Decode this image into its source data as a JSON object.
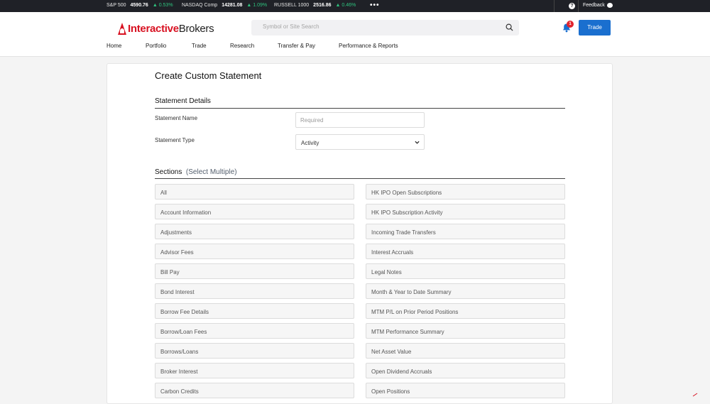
{
  "ticker": [
    {
      "name": "S&P 500",
      "value": "4590.76",
      "change": "▲ 0.53%"
    },
    {
      "name": "NASDAQ Comp",
      "value": "14281.08",
      "change": "▲ 1.09%"
    },
    {
      "name": "RUSSELL 1000",
      "value": "2516.86",
      "change": "▲ 0.46%"
    }
  ],
  "topbar": {
    "more": "•••",
    "help": "?",
    "feedback": "Feedback"
  },
  "brand": {
    "interactive": "Interactive",
    "brokers": "Brokers"
  },
  "search": {
    "placeholder": "Symbol or Site Search"
  },
  "notifications": {
    "count": "1"
  },
  "trade_button": "Trade",
  "nav": [
    "Home",
    "Portfolio",
    "Trade",
    "Research",
    "Transfer & Pay",
    "Performance & Reports"
  ],
  "page": {
    "title": "Create Custom Statement",
    "details_heading": "Statement Details",
    "name_label": "Statement Name",
    "name_placeholder": "Required",
    "type_label": "Statement Type",
    "type_value": "Activity",
    "sections_heading": "Sections",
    "sections_hint": "(Select Multiple)"
  },
  "sections_left": [
    "All",
    "Account Information",
    "Adjustments",
    "Advisor Fees",
    "Bill Pay",
    "Bond Interest",
    "Borrow Fee Details",
    "Borrow/Loan Fees",
    "Borrows/Loans",
    "Broker Interest",
    "Carbon Credits"
  ],
  "sections_right": [
    "HK IPO Open Subscriptions",
    "HK IPO Subscription Activity",
    "Incoming Trade Transfers",
    "Interest Accruals",
    "Legal Notes",
    "Month & Year to Date Summary",
    "MTM P/L on Prior Period Positions",
    "MTM Performance Summary",
    "Net Asset Value",
    "Open Dividend Accruals",
    "Open Positions"
  ],
  "colors": {
    "brand_red": "#d81222",
    "primary_blue": "#1a6fcf",
    "ticker_bg": "#1f2127",
    "gain_green": "#2ec27e"
  }
}
